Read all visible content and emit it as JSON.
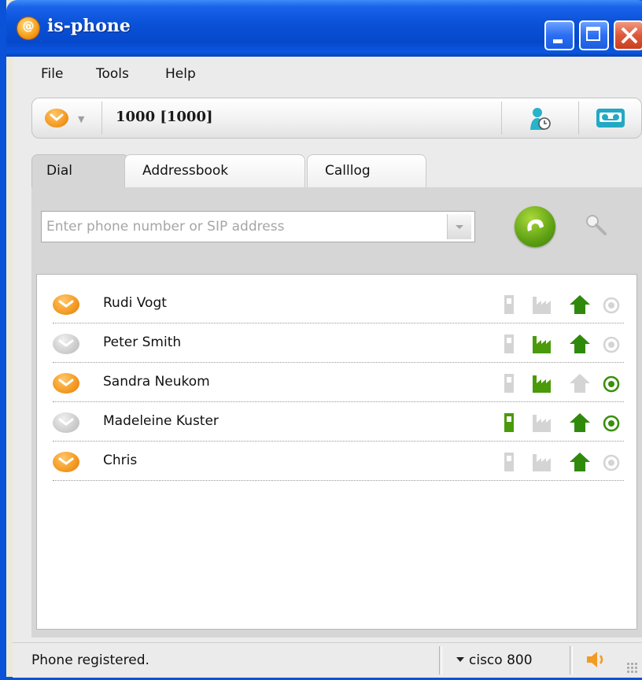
{
  "window": {
    "title": "is-phone",
    "colors": {
      "titlebar": "#0a52d8",
      "close": "#e0573a"
    }
  },
  "menu": {
    "items": [
      {
        "label": "File"
      },
      {
        "label": "Tools"
      },
      {
        "label": "Help"
      }
    ]
  },
  "toolbar": {
    "status_icon": "chat-bubble-icon",
    "account": "1000 [1000]",
    "icons": [
      "contact-history-icon",
      "voicemail-icon"
    ]
  },
  "tabs": [
    {
      "label": "Dial",
      "active": true
    },
    {
      "label": "Addressbook",
      "active": false
    },
    {
      "label": "Calllog",
      "active": false
    }
  ],
  "dial": {
    "placeholder": "Enter phone number or SIP address",
    "value": "",
    "call_icon": "call-icon",
    "search_icon": "search-icon"
  },
  "contacts": [
    {
      "name": "Rudi Vogt",
      "presence": "online",
      "mobile": false,
      "office": false,
      "home": true,
      "target": false
    },
    {
      "name": "Peter Smith",
      "presence": "offline",
      "mobile": false,
      "office": true,
      "home": true,
      "target": false
    },
    {
      "name": "Sandra Neukom",
      "presence": "online",
      "mobile": false,
      "office": true,
      "home": false,
      "target": true
    },
    {
      "name": "Madeleine Kuster",
      "presence": "offline",
      "mobile": true,
      "office": false,
      "home": true,
      "target": true
    },
    {
      "name": "Chris",
      "presence": "online",
      "mobile": false,
      "office": false,
      "home": true,
      "target": false
    }
  ],
  "statusbar": {
    "status": "Phone registered.",
    "device": "cisco 800"
  },
  "colors": {
    "presence_online": "#f39a22",
    "presence_offline": "#c8c8c8",
    "active_green": "#4a9a0a",
    "inactive_gray": "#d4d4d4"
  }
}
